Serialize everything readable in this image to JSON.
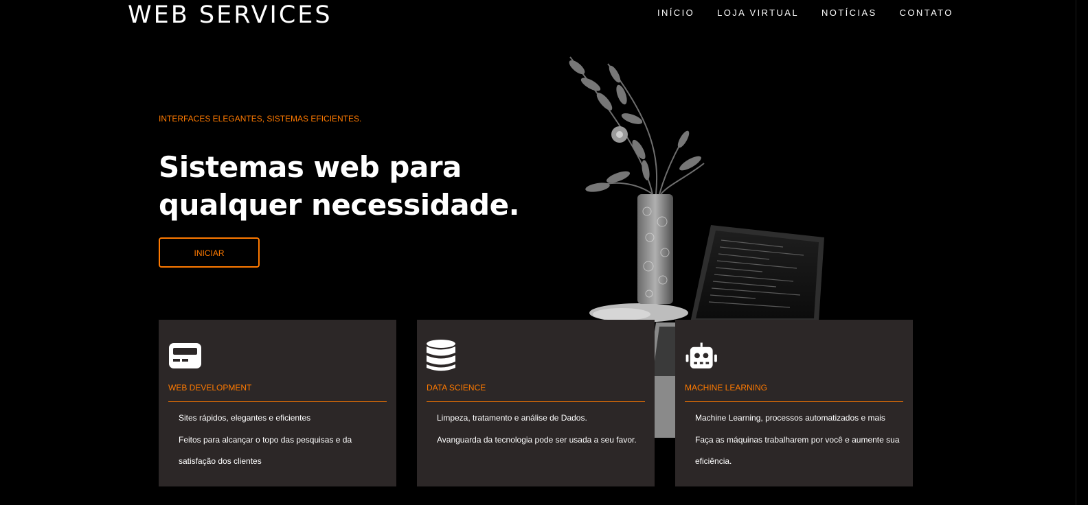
{
  "header": {
    "logo": "WEB SERVICES",
    "nav": [
      {
        "label": "INÍCIO"
      },
      {
        "label": "LOJA VIRTUAL"
      },
      {
        "label": "NOTÍCIAS"
      },
      {
        "label": "CONTATO"
      }
    ]
  },
  "hero": {
    "eyebrow": "INTERFACES ELEGANTES, SISTEMAS EFICIENTES.",
    "headline_line1": "Sistemas web para",
    "headline_line2": "qualquer necessidade.",
    "cta_label": "INICIAR",
    "image_icon": "plant-vase-laptop-photo"
  },
  "cards": [
    {
      "icon": "card-device-icon",
      "title": "WEB DEVELOPMENT",
      "lines": [
        "Sites rápidos, elegantes e eficientes",
        "Feitos para alcançar o topo das pesquisas e da satisfação dos clientes"
      ]
    },
    {
      "icon": "database-icon",
      "title": "DATA SCIENCE",
      "lines": [
        "Limpeza, tratamento e análise de Dados.",
        "Avanguarda da tecnologia pode ser usada a seu favor."
      ]
    },
    {
      "icon": "robot-icon",
      "title": "MACHINE LEARNING",
      "lines": [
        "Machine Learning, processos automatizados e mais",
        "Faça as máquinas trabalharem por você e aumente sua eficiência."
      ]
    }
  ],
  "colors": {
    "background": "#000000",
    "accent": "#ff7a00",
    "card": "#2c2727",
    "text": "#ffffff"
  }
}
